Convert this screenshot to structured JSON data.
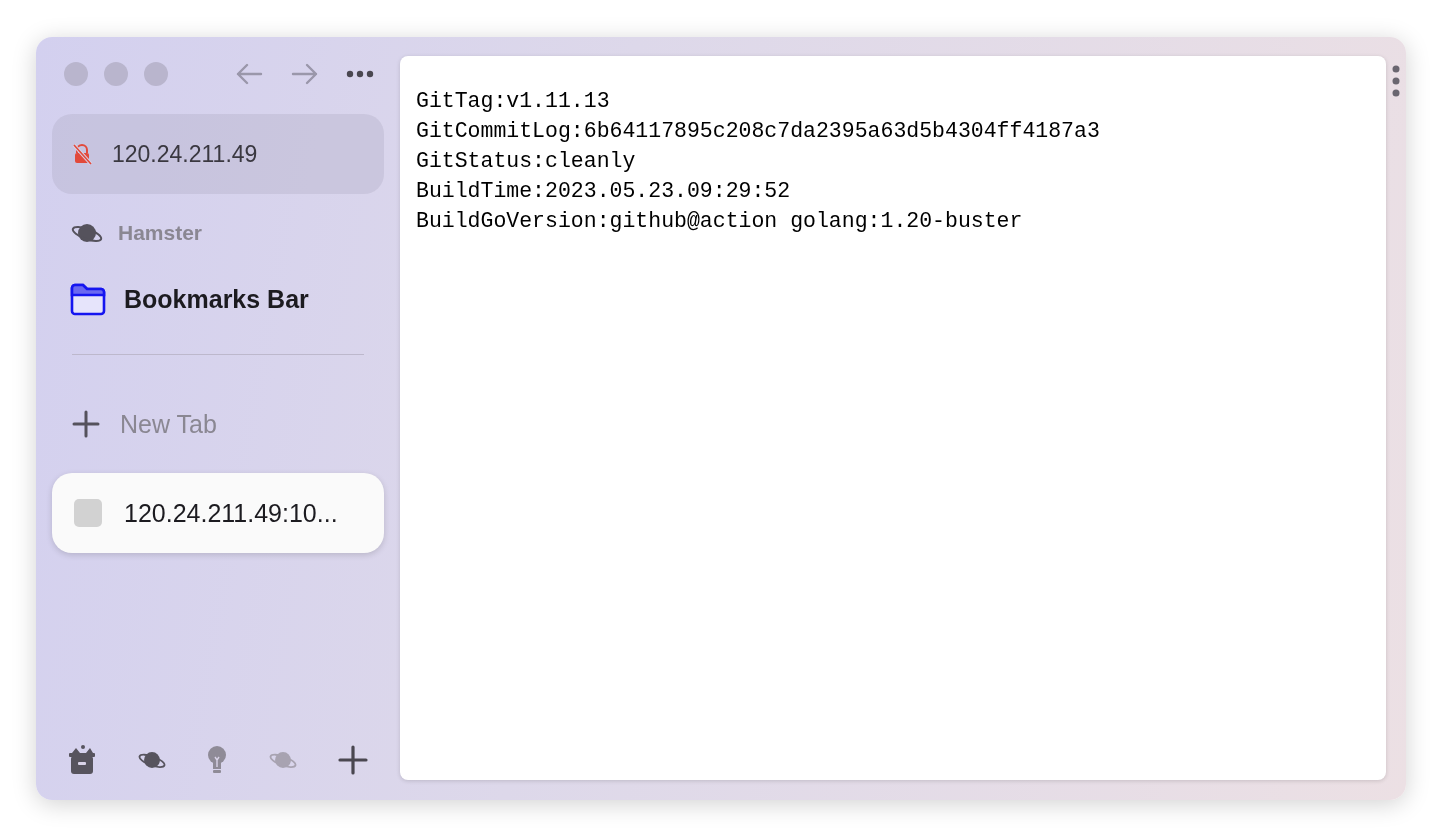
{
  "address_bar": {
    "text": "120.24.211.49",
    "secure": false
  },
  "space": {
    "name": "Hamster"
  },
  "bookmarks": [
    {
      "label": "Bookmarks Bar"
    }
  ],
  "new_tab": {
    "label": "New Tab"
  },
  "tabs": [
    {
      "title": "120.24.211.49:10...",
      "selected": true
    }
  ],
  "content": {
    "lines": [
      "GitTag:v1.11.13",
      "GitCommitLog:6b64117895c208c7da2395a63d5b4304ff4187a3",
      "GitStatus:cleanly",
      "BuildTime:2023.05.23.09:29:52",
      "BuildGoVersion:github@action golang:1.20-buster"
    ]
  }
}
